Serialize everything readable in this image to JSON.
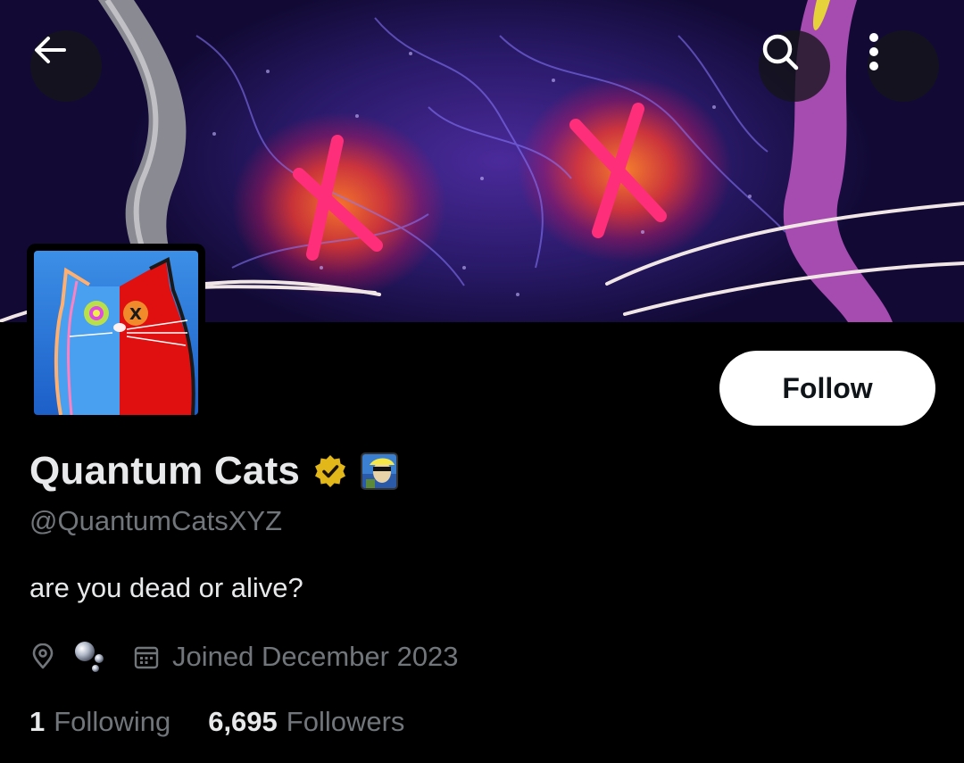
{
  "profile": {
    "display_name": "Quantum Cats",
    "handle": "@QuantumCatsXYZ",
    "bio": "are you dead or alive?",
    "joined": "Joined December 2023",
    "following_count": "1",
    "following_label": "Following",
    "followers_count": "6,695",
    "followers_label": "Followers"
  },
  "actions": {
    "follow_label": "Follow"
  },
  "icons": {
    "back": "arrow-left-icon",
    "search": "search-icon",
    "more": "more-vertical-icon",
    "location": "location-pin-icon",
    "bubbles": "bubbles-icon",
    "calendar": "calendar-icon",
    "verified": "verified-badge-icon"
  },
  "colors": {
    "background": "#000000",
    "text_primary": "#e7e9ea",
    "text_secondary": "#71767b",
    "verified_gold": "#e2b719"
  }
}
